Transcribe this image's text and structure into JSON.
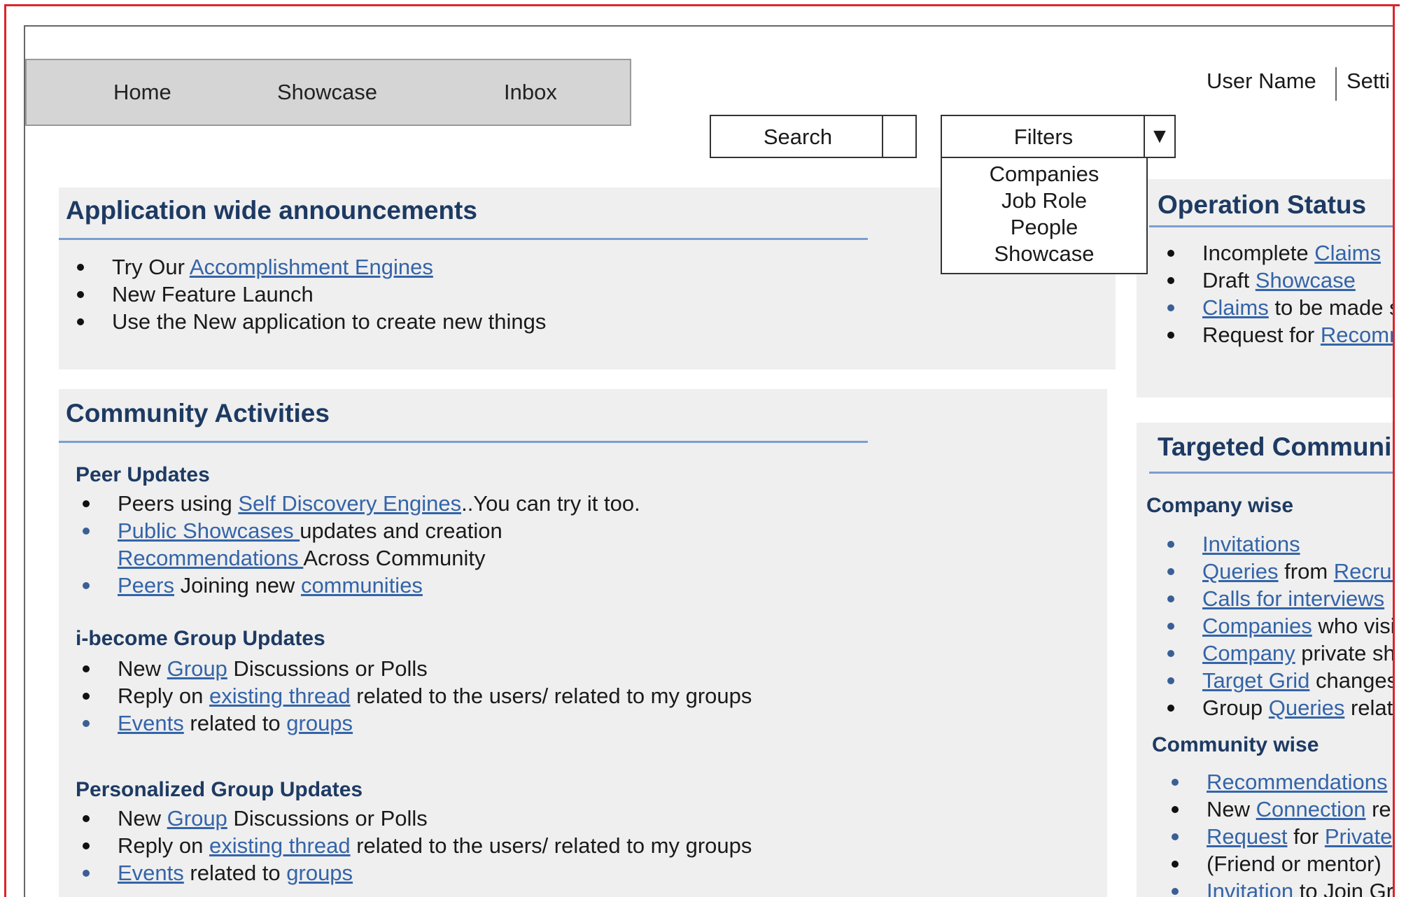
{
  "nav": {
    "home": "Home",
    "showcase": "Showcase",
    "inbox": "Inbox"
  },
  "user": {
    "name": "User Name",
    "settings": "Setti"
  },
  "search": {
    "label": "Search"
  },
  "filters": {
    "label": "Filters",
    "arrow": "▼",
    "options": [
      "Companies",
      "Job Role",
      "People",
      "Showcase"
    ]
  },
  "announcements": {
    "title": "Application wide announcements",
    "items": [
      {
        "pre": "Try Our ",
        "link": "Accomplishment Engines",
        "post": ""
      },
      {
        "pre": "New Feature Launch",
        "link": "",
        "post": ""
      },
      {
        "pre": "Use the New application to create new things",
        "link": "",
        "post": ""
      }
    ]
  },
  "community": {
    "title": "Community Activities",
    "peer": {
      "title": "Peer Updates",
      "l1_pre": "Peers using ",
      "l1_link": "Self Discovery Engines",
      "l1_post": "..You can try it too.",
      "l2_link": "Public Showcases ",
      "l2_post": "updates and creation",
      "l3_link": "Recommendations ",
      "l3_post": "Across Community",
      "l4_link": "Peers",
      "l4_mid": " Joining new ",
      "l4_link2": "communities"
    },
    "ibecome": {
      "title": "i-become Group Updates",
      "l1_pre": "New ",
      "l1_link": "Group",
      "l1_post": " Discussions or Polls",
      "l2_pre": "Reply on ",
      "l2_link": "existing thread",
      "l2_post": " related to the users/ related to my groups",
      "l3_link": "Events",
      "l3_mid": " related to ",
      "l3_link2": "groups"
    },
    "personal": {
      "title": "Personalized Group Updates",
      "l1_pre": "New ",
      "l1_link": "Group",
      "l1_post": " Discussions or Polls",
      "l2_pre": "Reply on ",
      "l2_link": "existing thread",
      "l2_post": " related to the users/ related to my groups",
      "l3_link": "Events",
      "l3_mid": " related to ",
      "l3_link2": "groups"
    }
  },
  "operation": {
    "title": "Operation Status",
    "l1_pre": "Incomplete ",
    "l1_link": "Claims",
    "l2_pre": "Draft ",
    "l2_link": "Showcase",
    "l3_link": "Claims",
    "l3_post": " to be made s",
    "l4_pre": "Request for ",
    "l4_link": "Recomm"
  },
  "targeted": {
    "title": "Targeted Communi",
    "company": {
      "title": "Company wise",
      "l1_link": "Invitations",
      "l2_link": "Queries",
      "l2_mid": " from ",
      "l2_link2": "Recrui",
      "l3_link": "Calls for interviews",
      "l4_link": "Companies",
      "l4_post": " who visi",
      "l5_link": "Company",
      "l5_post": " private sh",
      "l6_link": "Target Grid",
      "l6_post": " changes",
      "l7_pre": "Group ",
      "l7_link": "Queries",
      "l7_post": " relat"
    },
    "community": {
      "title": "Community wise",
      "l1_link": "Recommendations",
      "l2_pre": "New ",
      "l2_link": "Connection",
      "l2_post": " re",
      "l3_link": "Request",
      "l3_mid": " for ",
      "l3_link2": "Private",
      "l4_pre": "(Friend or mentor)",
      "l5_link": "Invitation",
      "l5_post": " to Join Gr"
    }
  }
}
